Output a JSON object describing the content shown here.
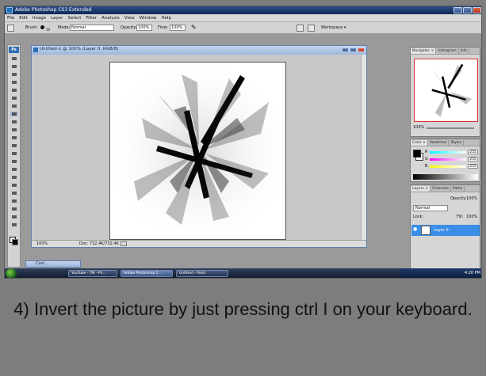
{
  "window": {
    "title": "Adobe Photoshop CS3 Extended"
  },
  "menubar": [
    "File",
    "Edit",
    "Image",
    "Layer",
    "Select",
    "Filter",
    "Analysis",
    "View",
    "Window",
    "Help"
  ],
  "options": {
    "brush_label": "Brush:",
    "brush_size": "19",
    "mode_label": "Mode:",
    "mode_value": "Normal",
    "opacity_label": "Opacity:",
    "opacity_value": "100%",
    "flow_label": "Flow:",
    "flow_value": "100%",
    "workspace_label": "Workspace ▾"
  },
  "toolbox": {
    "logo": "Ps"
  },
  "document": {
    "title": "Untitled-1 @ 100% (Layer 0, RGB/8)",
    "zoom": "100%",
    "doc_size": "Doc: 732.4K/732.4K"
  },
  "navigator": {
    "tabs": [
      "Navigator ×",
      "Histogram",
      "Info"
    ],
    "zoom": "100%"
  },
  "color_panel": {
    "tabs": [
      "Color ×",
      "Swatches",
      "Styles"
    ],
    "channels": [
      {
        "label": "R",
        "value": "255",
        "color": "#d23a3a"
      },
      {
        "label": "G",
        "value": "255",
        "color": "#3ab34a"
      },
      {
        "label": "B",
        "value": "255",
        "color": "#3a55d2"
      }
    ]
  },
  "layers_panel": {
    "tabs": [
      "Layers ×",
      "Channels",
      "Paths"
    ],
    "blend_mode": "Normal",
    "opacity_label": "Opacity:",
    "opacity_value": "100%",
    "lock_label": "Lock:",
    "fill_label": "Fill:",
    "fill_value": "100%",
    "layer_name": "Layer 0"
  },
  "minimized_doc": {
    "title": "Cool ..."
  },
  "taskbar": {
    "tasks": [
      "YouTube - TM - Ph...",
      "Adobe Photoshop C...",
      "Untitled - Paint"
    ],
    "clock": "4:20 PM"
  },
  "caption": "4) Invert the picture by just pressing ctrl I on your keyboard.",
  "colors": {
    "selection_blue": "#3a8ee6",
    "title_bar": "#0e2a57"
  }
}
